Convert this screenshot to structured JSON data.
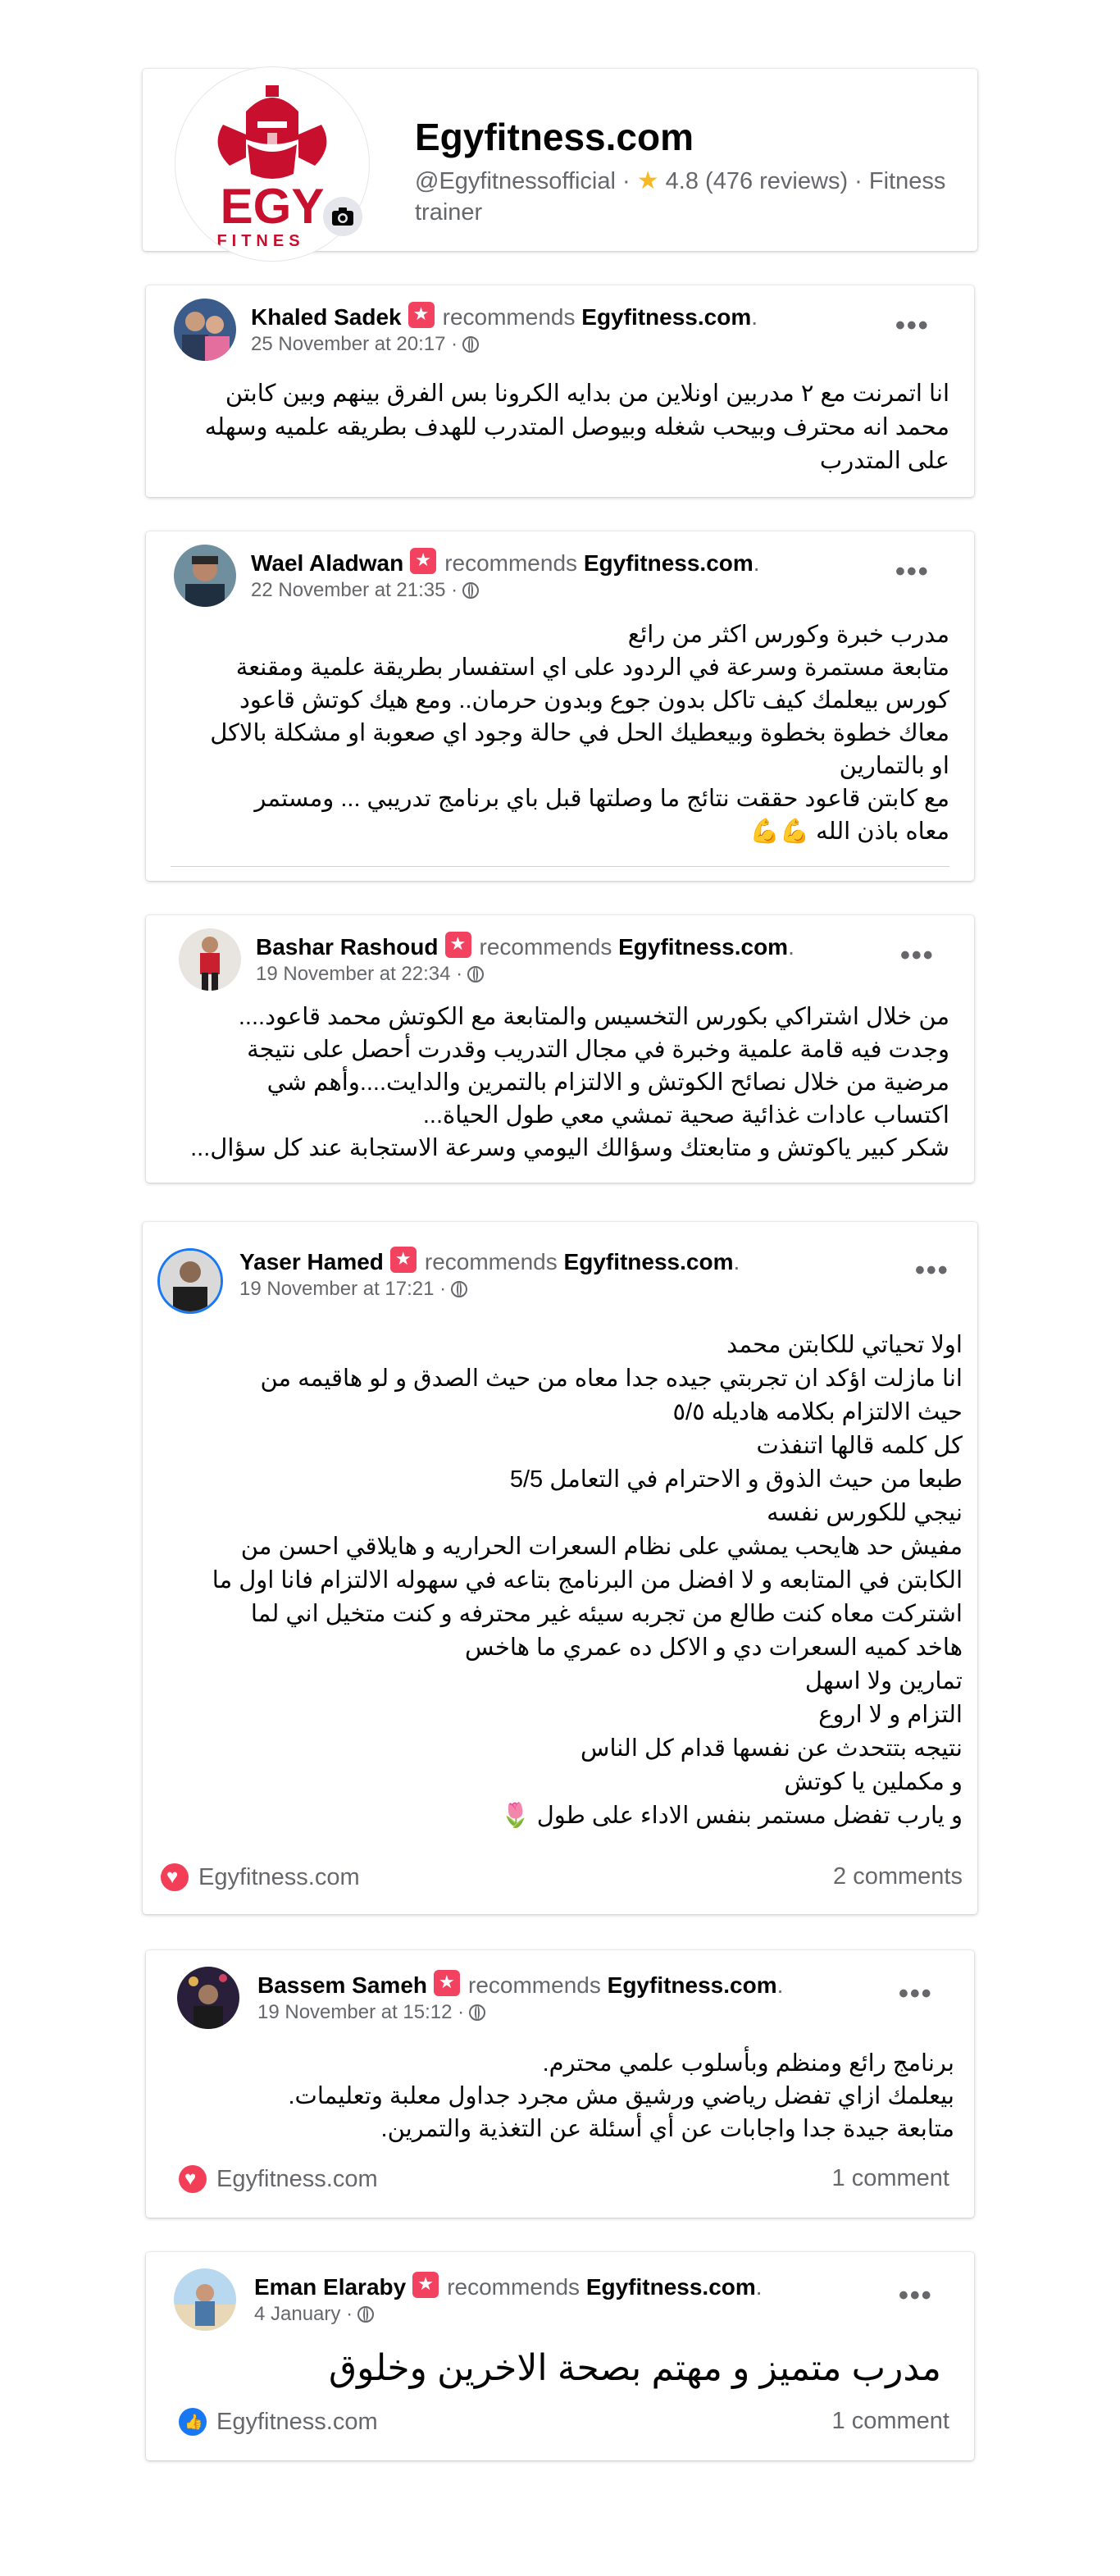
{
  "page": {
    "title": "Egyfitness.com",
    "handle": "@Egyfitnessofficial",
    "rating": "4.8",
    "reviews_text": "(476 reviews)",
    "category": "Fitness trainer",
    "logo_text_main": "EGY",
    "logo_text_sub": "FITNES"
  },
  "labels": {
    "recommends": "recommends",
    "page_name": "Egyfitness.com"
  },
  "reviews": [
    {
      "name": "Khaled Sadek",
      "date": "25 November at 20:17 ·",
      "text": "انا اتمرنت مع ٢ مدربين اونلاين من بدايه الكرونا بس الفرق بينهم وبين كابتن\nمحمد انه محترف وبيحب شغله وبيوصل المتدرب للهدف بطريقه علميه وسهله\nعلى المتدرب"
    },
    {
      "name": "Wael Aladwan",
      "date": "22 November at 21:35 ·",
      "text": "مدرب خبرة وكورس اكثر من رائع\nمتابعة مستمرة وسرعة في الردود على اي استفسار بطريقة علمية ومقنعة\nكورس بيعلمك كيف تاكل بدون جوع وبدون حرمان.. ومع هيك كوتش قاعود\nمعاك خطوة بخطوة وبيعطيك الحل في حالة وجود اي صعوبة او مشكلة بالاكل\nاو بالتمارين\nمع كابتن قاعود حققت نتائج ما وصلتها قبل باي برنامج تدريبي ... ومستمر\nمعاه باذن الله 💪💪"
    },
    {
      "name": "Bashar Rashoud",
      "date": "19 November at 22:34 ·",
      "text": "من خلال اشتراكي بكورس التخسيس والمتابعة مع الكوتش محمد قاعود....\nوجدت فيه قامة علمية وخبرة في مجال التدريب وقدرت أحصل على نتيجة\nمرضية من خلال نصائح الكوتش و الالتزام بالتمرين والدايت....وأهم شي\nاكتساب عادات غذائية صحية تمشي معي طول الحياة...\nشكر كبير ياكوتش و متابعتك وسؤالك اليومي وسرعة الاستجابة عند كل سؤال..."
    },
    {
      "name": "Yaser Hamed",
      "date": "19 November at 17:21 ·",
      "text": "اولا تحياتي للكابتن محمد\nانا مازلت اؤكد ان تجربتي جيده جدا معاه من حيث الصدق و لو هاقيمه من\nحيث الالتزام بكلامه هاديله ٥/٥\nكل كلمه قالها اتنفذت\nطبعا من حيث الذوق و الاحترام في التعامل 5/5\nنيجي للكورس نفسه\nمفيش حد هايحب يمشي على نظام السعرات الحراريه و هايلاقي احسن من\nالكابتن في المتابعه و لا افضل من البرنامج بتاعه في سهوله الالتزام فانا اول ما\nاشتركت معاه كنت طالع من تجربه سيئه غير محترفه و كنت متخيل اني لما\nهاخد كميه السعرات دي و الاكل ده عمري ما هاخس\nتمارين ولا اسهل\nالتزام و لا اروع\nنتيجه بتتحدث عن نفسها قدام كل الناس\nو مكملين يا كوتش\nو يارب تفضل مستمر بنفس الاداء على طول 🌷",
      "footer_page": "Egyfitness.com",
      "comments": "2 comments"
    },
    {
      "name": "Bassem Sameh",
      "date": "19 November at 15:12 ·",
      "text": "برنامج رائع ومنظم وبأسلوب علمي محترم.\nبيعلمك ازاي تفضل رياضي ورشيق مش مجرد جداول معلبة وتعليمات.\nمتابعة جيدة جدا واجابات عن أي أسئلة عن التغذية والتمرين.",
      "footer_page": "Egyfitness.com",
      "comments": "1 comment"
    },
    {
      "name": "Eman Elaraby",
      "date": "4 January ·",
      "text": "مدرب متميز و مهتم بصحة الاخرين وخلوق",
      "footer_page": "Egyfitness.com",
      "comments": "1 comment"
    }
  ],
  "icons": {
    "star": "star-icon",
    "camera": "camera-icon",
    "globe": "globe-icon",
    "more": "more-options-icon",
    "recommend": "recommend-badge-icon",
    "love": "love-reaction-icon",
    "like": "like-reaction-icon"
  },
  "colors": {
    "brand_red": "#c8102e",
    "recommend_badge": "#f3425f",
    "love": "#f33e58",
    "like": "#1877f2",
    "secondary_text": "#65676b"
  }
}
